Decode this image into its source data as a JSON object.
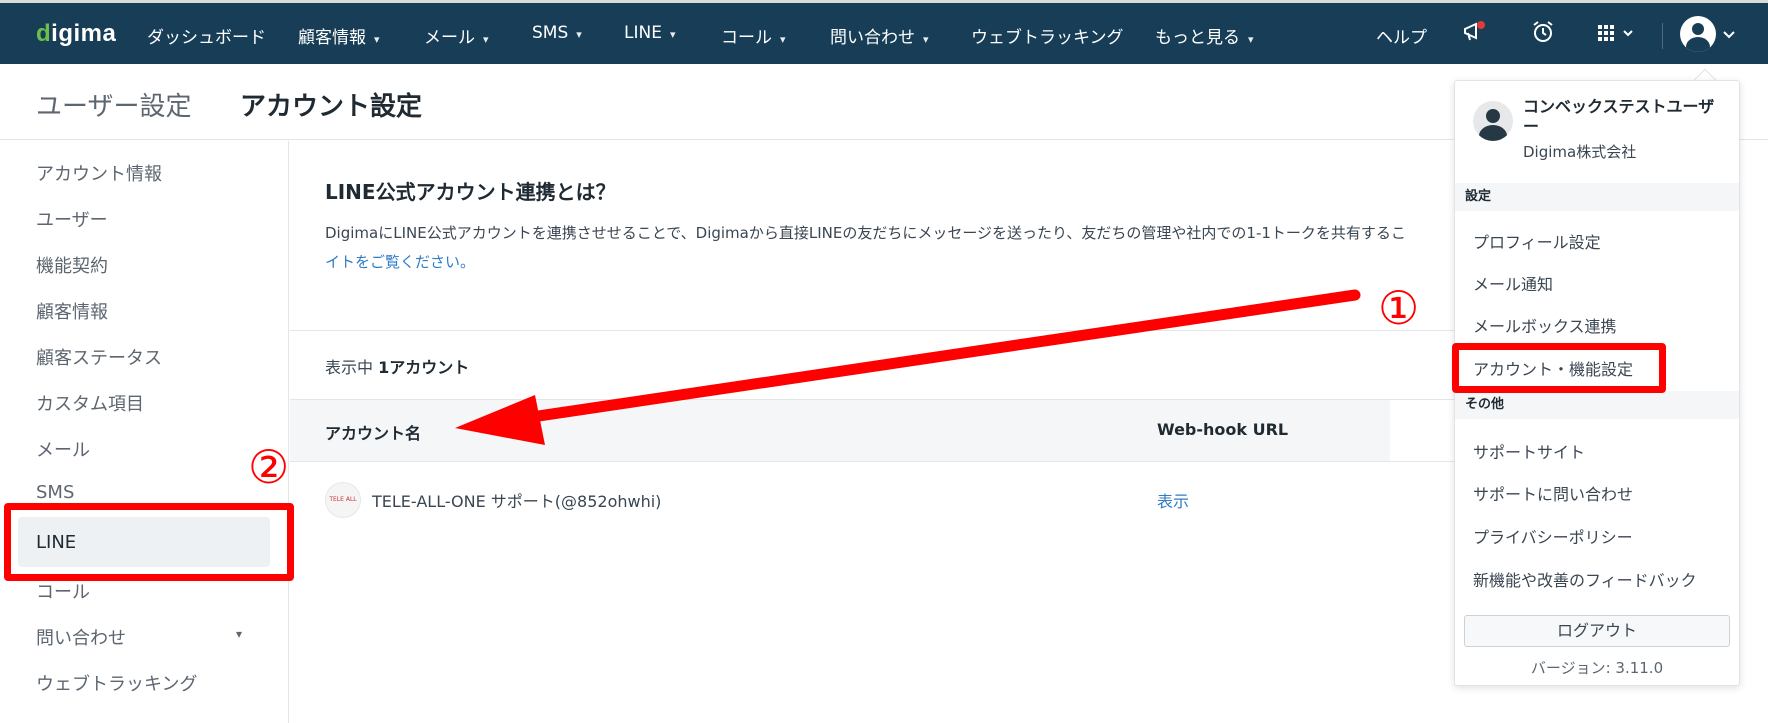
{
  "app": {
    "logo_prefix": "d",
    "logo_rest": "igima"
  },
  "nav": {
    "items": [
      {
        "label": "ダッシュボード",
        "dropdown": false
      },
      {
        "label": "顧客情報",
        "dropdown": true
      },
      {
        "label": "メール",
        "dropdown": true
      },
      {
        "label": "SMS",
        "dropdown": true
      },
      {
        "label": "LINE",
        "dropdown": true
      },
      {
        "label": "コール",
        "dropdown": true
      },
      {
        "label": "問い合わせ",
        "dropdown": true
      },
      {
        "label": "ウェブトラッキング",
        "dropdown": false
      },
      {
        "label": "もっと見る",
        "dropdown": true
      }
    ],
    "help_label": "ヘルプ",
    "chev": "⌄"
  },
  "breadcrumb": {
    "parent": "ユーザー設定",
    "current": "アカウント設定"
  },
  "sidebar": {
    "items": [
      {
        "label": "アカウント情報"
      },
      {
        "label": "ユーザー"
      },
      {
        "label": "機能契約"
      },
      {
        "label": "顧客情報"
      },
      {
        "label": "顧客ステータス"
      },
      {
        "label": "カスタム項目"
      },
      {
        "label": "メール"
      },
      {
        "label": "SMS"
      },
      {
        "label": "LINE"
      },
      {
        "label": "コール"
      },
      {
        "label": "問い合わせ"
      },
      {
        "label": "ウェブトラッキング"
      }
    ],
    "active_index": 8
  },
  "main": {
    "title": "LINE公式アカウント連携とは？",
    "description": "DigimaにLINE公式アカウントを連携させせることで、Digimaから直接LINEの友だちにメッセージを送ったり、友だちの管理や社内での1-1トークを共有するこ",
    "link_text": "イトをご覧ください。",
    "count_prefix": "表示中 ",
    "count_value": "1アカウント",
    "table": {
      "columns": [
        "アカウント名",
        "Web-hook URL"
      ],
      "rows": [
        {
          "name": "TELE-ALL-ONE サポート(@852ohwhi)",
          "webhook": "表示"
        }
      ]
    }
  },
  "user_menu": {
    "user_name": "コンベックステストユーザー",
    "company": "Digima株式会社",
    "section_settings": "設定",
    "settings_items": [
      "プロフィール設定",
      "メール通知",
      "メールボックス連携",
      "アカウント・機能設定"
    ],
    "section_other": "その他",
    "other_items": [
      "サポートサイト",
      "サポートに問い合わせ",
      "プライバシーポリシー",
      "新機能や改善のフィードバック"
    ],
    "logout_label": "ログアウト",
    "version": "バージョン: 3.11.0"
  },
  "annotations": {
    "step1": "①",
    "step2": "②",
    "color": "#ff0000"
  }
}
